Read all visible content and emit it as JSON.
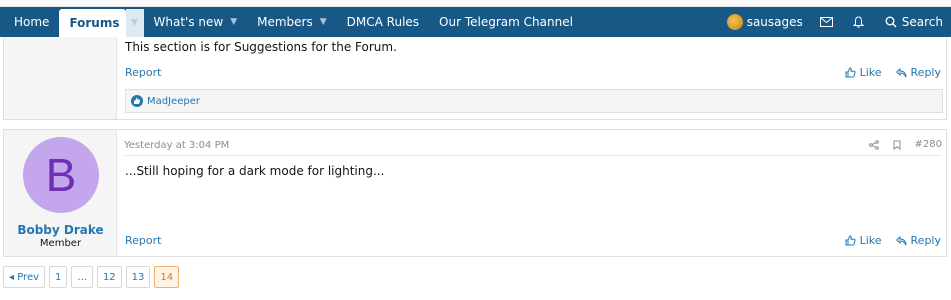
{
  "nav": {
    "tabs": [
      "Home",
      "Forums",
      "What's new",
      "Members",
      "DMCA Rules",
      "Our Telegram Channel"
    ],
    "username": "sausages",
    "search_label": "Search"
  },
  "post1": {
    "text": "This section is for Suggestions for the Forum.",
    "report_label": "Report",
    "like_label": "Like",
    "reply_label": "Reply",
    "reaction_user": "MadJeeper"
  },
  "post2": {
    "author": "Bobby Drake",
    "author_initial": "B",
    "author_title": "Member",
    "timestamp": "Yesterday at 3:04 PM",
    "post_number": "#280",
    "text": "...Still hoping for a dark mode for lighting...",
    "report_label": "Report",
    "like_label": "Like",
    "reply_label": "Reply"
  },
  "pagination": {
    "prev_label": "◂ Prev",
    "pages": [
      "1",
      "...",
      "12",
      "13",
      "14"
    ],
    "current": "14"
  },
  "colors": {
    "nav_bg": "#185886",
    "link": "#2577b1",
    "avatar_bg": "#c4a6ec",
    "avatar_fg": "#6f2fb2"
  }
}
